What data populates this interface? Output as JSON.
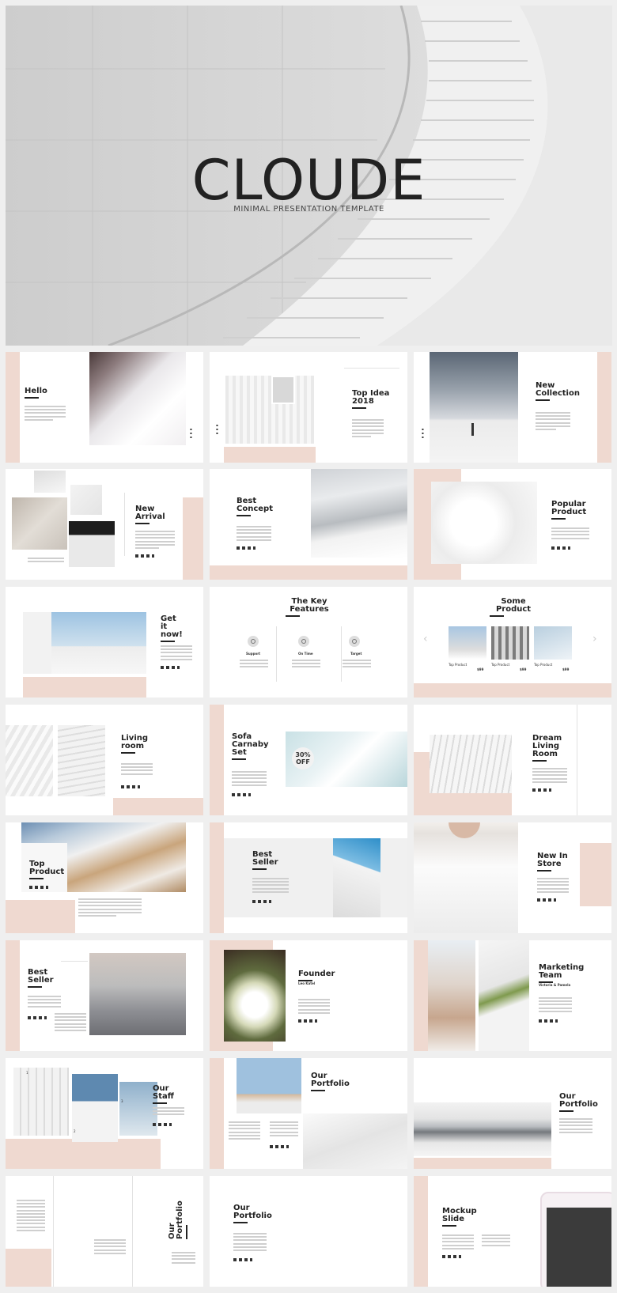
{
  "hero": {
    "title": "CLOUDE",
    "subtitle": "MINIMAL PRESENTATION TEMPLATE"
  },
  "slides": {
    "s1": "Hello",
    "s2": "Top Idea 2018",
    "s3": "New Collection",
    "s4": "New Arrival",
    "s5": "Best Concept",
    "s6": "Popular Product",
    "s7": "Get it now!",
    "s8": "The Key Features",
    "s9": "Some Product",
    "s10": "Living room",
    "s11": "Sofa Carnaby Set",
    "s12": "Dream Living Room",
    "s13": "Top Product",
    "s14": "Best Seller",
    "s15": "New In Store",
    "s16": "Best Seller",
    "s17": "Founder",
    "s18": "Marketing Team",
    "s19": "Our Staff",
    "s20": "Our Portfolio",
    "s21": "Our Portfolio",
    "s22": "Our Portfolio",
    "s23": "Our Portfolio",
    "s24": "Mockup Slide"
  },
  "s2_year_label": "Top Idea 2018",
  "s8_features": [
    "Support",
    "On Time",
    "Target"
  ],
  "s9_items": [
    {
      "name": "Top Product",
      "price": "$99"
    },
    {
      "name": "Top Product",
      "price": "$99"
    },
    {
      "name": "Top Product",
      "price": "$99"
    }
  ],
  "s11_badge": "30% OFF",
  "s17_subtitle": "Leo Katel",
  "s18_subtitle": "Victoria & Pamela",
  "s19_numbers": [
    "1",
    "2",
    "3"
  ],
  "colors": {
    "accent_pink": "#efd9d0",
    "dark_text": "#222222",
    "background": "#efefef"
  },
  "icons": [
    "support-icon",
    "clock-icon",
    "target-icon",
    "chevron-left-icon",
    "chevron-right-icon",
    "social-icons"
  ]
}
